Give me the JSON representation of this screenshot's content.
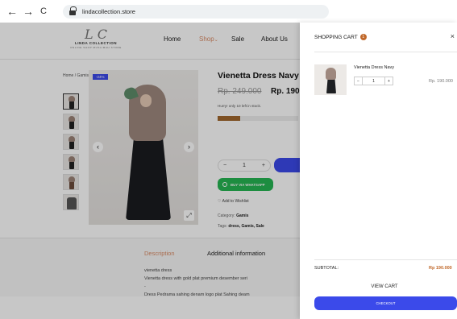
{
  "browser": {
    "back": "←",
    "forward": "→",
    "reload": "C",
    "url": "lindacollection.store"
  },
  "site": {
    "logo_mark": "L C",
    "logo_name": "LINDA COLLECTION",
    "logo_tagline": "ONLINE SHOP MUSLIMAH STORE",
    "menu": [
      "Home",
      "Shop",
      "Sale",
      "About Us"
    ],
    "menu_active_suffix": "⌄",
    "breadcrumb": "Home / Gamis / Vienetta Dress Navy"
  },
  "product": {
    "badge": "-24%",
    "title": "Vienetta Dress Navy",
    "price_old": "Rp. 249.000",
    "price_new": "Rp. 190.",
    "stock_text": "Hurry! only 10 left in stock.",
    "stock_fraction": 0.28,
    "qty_minus": "−",
    "qty_value": "1",
    "qty_plus": "+",
    "whatsapp_label": "BUY VIA WHATSAPP",
    "wishlist_label": "Add to Wishlist",
    "category_label": "Category:",
    "category_value": "Gamis",
    "tags_label": "Tags:",
    "tags_value": "dress, Gamis, Sale",
    "prev_arrow": "‹",
    "next_arrow": "›",
    "zoom_icon": "⤢"
  },
  "tabs": {
    "description": "Description",
    "additional": "Additional information"
  },
  "description_lines": [
    "vienetta dress",
    "Vienetta dress with gold plat premium desember seri",
    "-",
    "Dress Pedrama sahing denam logo plat Sahing deam"
  ],
  "cart": {
    "title": "SHOPPING CART",
    "count": "1",
    "close": "×",
    "item_name": "Vienetta Dress Navy",
    "item_qty_minus": "−",
    "item_qty": "1",
    "item_qty_plus": "+",
    "item_price": "Rp. 190.000",
    "subtotal_label": "SUBTOTAL:",
    "subtotal_value": "Rp 190.000",
    "view_cart": "VIEW CART",
    "checkout": "CHECKOUT"
  },
  "colors": {
    "accent_blue": "#3b4aea",
    "accent_orange": "#d98a64",
    "whatsapp_green": "#26b553"
  }
}
